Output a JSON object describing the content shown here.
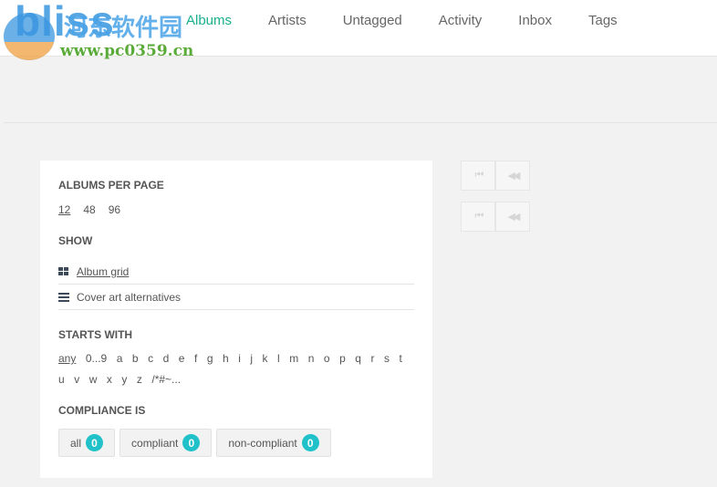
{
  "watermark": {
    "logo": "bliss",
    "cn": "河东软件园",
    "url": "www.pc0359.cn"
  },
  "nav": [
    {
      "label": "Albums",
      "active": true
    },
    {
      "label": "Artists"
    },
    {
      "label": "Untagged"
    },
    {
      "label": "Activity"
    },
    {
      "label": "Inbox"
    },
    {
      "label": "Tags"
    }
  ],
  "panel": {
    "per_page_title": "ALBUMS PER PAGE",
    "per_page": [
      "12",
      "48",
      "96"
    ],
    "show_title": "SHOW",
    "show": [
      "Album grid",
      "Cover art alternatives"
    ],
    "starts_title": "STARTS WITH",
    "letters": [
      "any",
      "0...9",
      "a",
      "b",
      "c",
      "d",
      "e",
      "f",
      "g",
      "h",
      "i",
      "j",
      "k",
      "l",
      "m",
      "n",
      "o",
      "p",
      "q",
      "r",
      "s",
      "t",
      "u",
      "v",
      "w",
      "x",
      "y",
      "z",
      "/*#~..."
    ],
    "compliance_title": "COMPLIANCE IS",
    "compliance": [
      {
        "label": "all",
        "count": "0"
      },
      {
        "label": "compliant",
        "count": "0"
      },
      {
        "label": "non-compliant",
        "count": "0"
      }
    ]
  },
  "pager": {
    "first": "⏮",
    "prev": "◀◀"
  },
  "colors": {
    "accent": "#1aaf8f",
    "badge": "#21c1c9"
  }
}
